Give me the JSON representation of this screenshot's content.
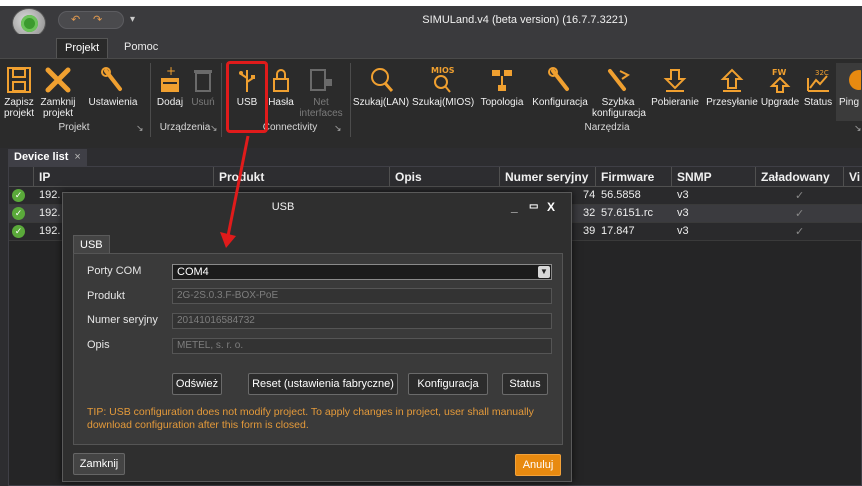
{
  "page_heading": "",
  "app": {
    "window_title": "SIMULand.v4 (beta version) (16.7.7.3221)",
    "qat_icons": [
      "undo-icon",
      "redo-icon"
    ],
    "menu_tabs": [
      "Projekt",
      "Pomoc"
    ]
  },
  "ribbon": {
    "groups": {
      "projekt": "Projekt",
      "urzadzenia": "Urządzenia",
      "connectivity": "Connectivity",
      "narzedzia": "Narzędzia"
    },
    "buttons": {
      "save": [
        "Zapisz",
        "projekt"
      ],
      "close_project": [
        "Zamknij",
        "projekt"
      ],
      "settings": "Ustawienia",
      "add": "Dodaj",
      "remove": "Usuń",
      "usb": "USB",
      "passwords": "Hasła",
      "net_interfaces": [
        "Net",
        "interfaces"
      ],
      "search_lan": "Szukaj(LAN)",
      "search_mios": "Szukaj(MIOS)",
      "topology": "Topologia",
      "configuration": "Konfiguracja",
      "quick_config": [
        "Szybka",
        "konfiguracja"
      ],
      "download": "Pobieranie",
      "upload": "Przesyłanie",
      "upgrade": "Upgrade",
      "status": "Status",
      "ping": "Ping"
    },
    "icon_badges": {
      "mios": "MIOS",
      "fw": "FW",
      "temp": "32C"
    },
    "launcher_glyph": "↘"
  },
  "document_tab": {
    "label": "Device list",
    "close_glyph": "×"
  },
  "grid": {
    "columns": [
      "IP",
      "Produkt",
      "Opis",
      "Numer seryjny",
      "Firmware",
      "SNMP",
      "Załadowany",
      "Vi"
    ],
    "rows": [
      {
        "ip": "192.",
        "serial": "74",
        "firmware": "56.5858",
        "snmp": "v3",
        "loaded": "✓"
      },
      {
        "ip": "192.",
        "serial": "32",
        "firmware": "57.6151.rc",
        "snmp": "v3",
        "loaded": "✓"
      },
      {
        "ip": "192.",
        "serial": "39",
        "firmware": "17.847",
        "snmp": "v3",
        "loaded": "✓"
      }
    ],
    "row_check": "✓"
  },
  "dialog": {
    "title": "USB",
    "controls": [
      "_",
      "▭",
      "X"
    ],
    "tab": "USB",
    "fields": {
      "porty_com": {
        "label": "Porty COM",
        "value": "COM4"
      },
      "produkt": {
        "label": "Produkt",
        "value": "2G-2S.0.3.F-BOX-PoE"
      },
      "numer": {
        "label": "Numer seryjny",
        "value": "20141016584732"
      },
      "opis": {
        "label": "Opis",
        "value": "METEL, s. r. o."
      }
    },
    "buttons": {
      "refresh": "Odśwież",
      "reset": "Reset (ustawienia fabryczne)",
      "config": "Konfiguracja",
      "status": "Status"
    },
    "tip": "TIP: USB configuration does not modify project. To apply changes in project, user shall manually download configuration after this form is closed.",
    "close": "Zamknij",
    "cancel": "Anuluj"
  },
  "colors": {
    "accent_orange": "#e88a10",
    "highlight_red": "#e01b1b",
    "ok_green": "#5aa93a"
  }
}
